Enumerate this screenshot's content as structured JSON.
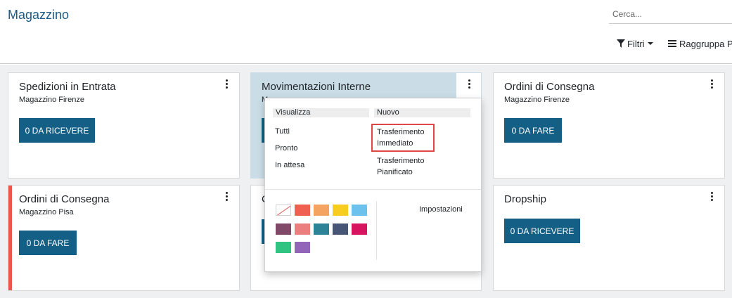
{
  "header": {
    "title": "Magazzino",
    "search_placeholder": "Cerca...",
    "filters_label": "Filtri",
    "group_by_label": "Raggruppa Per"
  },
  "cards": [
    {
      "title": "Spedizioni in Entrata",
      "subtitle": "Magazzino Firenze",
      "button": "0 DA RICEVERE"
    },
    {
      "title": "Movimentazioni Interne",
      "subtitle": "M"
    },
    {
      "title": "Ordini di Consegna",
      "subtitle": "Magazzino Firenze",
      "button": "0 DA FARE"
    },
    {
      "title": "Ordini di Consegna",
      "subtitle": "Magazzino Pisa",
      "button": "0 DA FARE"
    },
    {
      "title": "C"
    },
    {
      "title": "Dropship",
      "button": "0 DA RICEVERE"
    }
  ],
  "dropdown": {
    "view_header": "Visualizza",
    "view_items": [
      "Tutti",
      "Pronto",
      "In attesa"
    ],
    "new_header": "Nuovo",
    "new_items": [
      "Trasferimento Immediato",
      "Trasferimento Pianificato"
    ],
    "settings_label": "Impostazioni",
    "colors": [
      "none",
      "#f06050",
      "#f4a460",
      "#f7cd1f",
      "#6cc1ed",
      "#814968",
      "#eb7e7f",
      "#2c8397",
      "#475577",
      "#d6145f",
      "#30c381",
      "#9365b8"
    ]
  },
  "colors": {
    "accent": "#145f85",
    "title": "#1d5c87",
    "highlight_border": "#e04646",
    "selected_card_bg": "#cadde7"
  }
}
